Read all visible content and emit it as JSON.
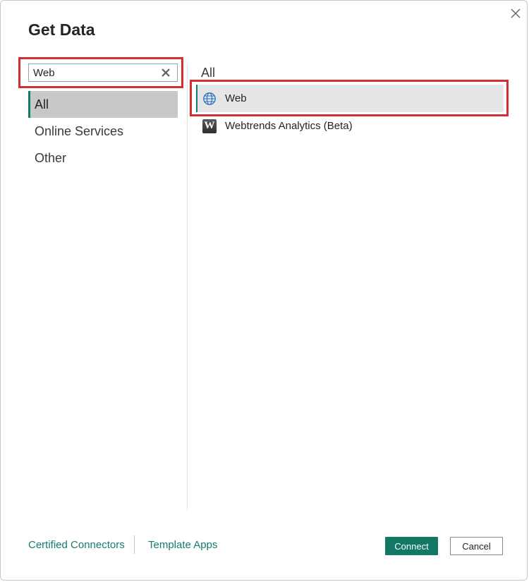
{
  "dialog": {
    "title": "Get Data"
  },
  "search": {
    "value": "Web"
  },
  "categories": [
    {
      "label": "All",
      "selected": true
    },
    {
      "label": "Online Services",
      "selected": false
    },
    {
      "label": "Other",
      "selected": false
    }
  ],
  "results": {
    "heading": "All",
    "items": [
      {
        "label": "Web",
        "icon": "globe-icon",
        "selected": true
      },
      {
        "label": "Webtrends Analytics (Beta)",
        "icon": "webtrends-icon",
        "selected": false
      }
    ]
  },
  "footer": {
    "certified_connectors": "Certified Connectors",
    "template_apps": "Template Apps",
    "connect": "Connect",
    "cancel": "Cancel"
  },
  "colors": {
    "accent": "#107c6e",
    "connect_button": "#117865",
    "highlight_box": "#d32f2f",
    "selected_category_bg": "#c8c8c8",
    "selected_result_bg": "#e6e6e6"
  }
}
